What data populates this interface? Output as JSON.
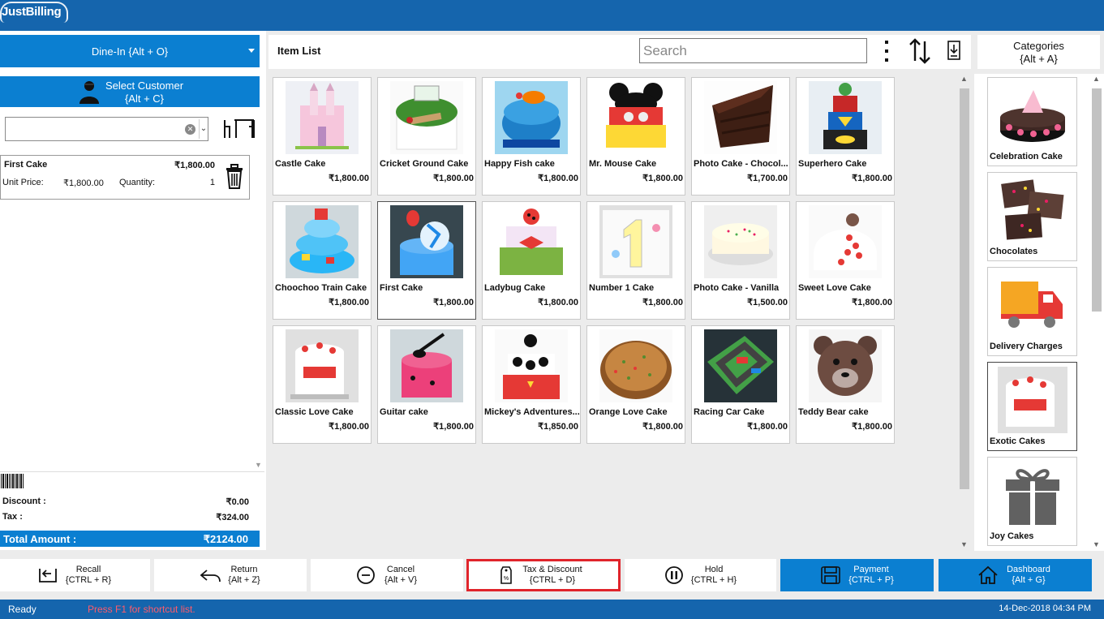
{
  "app": {
    "logo_text": "JustBilling"
  },
  "left": {
    "dine_in_label": "Dine-In {Alt + O}",
    "select_customer_line1": "Select Customer",
    "select_customer_line2": "{Alt + C}",
    "customer_input_value": "",
    "cart": [
      {
        "name": "First Cake",
        "amount": "₹1,800.00",
        "unit_price_label": "Unit Price:",
        "unit_price": "₹1,800.00",
        "quantity_label": "Quantity:",
        "quantity": "1"
      }
    ],
    "discount_label": "Discount :",
    "discount_value": "₹0.00",
    "tax_label": "Tax :",
    "tax_value": "₹324.00",
    "total_label": "Total Amount :",
    "total_value": "₹2124.00"
  },
  "item_list": {
    "title": "Item List",
    "search_placeholder": "Search",
    "items": [
      {
        "name": "Castle Cake",
        "price": "₹1,800.00"
      },
      {
        "name": "Cricket Ground Cake",
        "price": "₹1,800.00"
      },
      {
        "name": "Happy Fish cake",
        "price": "₹1,800.00"
      },
      {
        "name": "Mr. Mouse Cake",
        "price": "₹1,800.00"
      },
      {
        "name": "Photo Cake - Chocol...",
        "price": "₹1,700.00"
      },
      {
        "name": "Superhero Cake",
        "price": "₹1,800.00"
      },
      {
        "name": "Choochoo Train Cake",
        "price": "₹1,800.00"
      },
      {
        "name": "First Cake",
        "price": "₹1,800.00"
      },
      {
        "name": "Ladybug Cake",
        "price": "₹1,800.00"
      },
      {
        "name": "Number 1 Cake",
        "price": "₹1,800.00"
      },
      {
        "name": "Photo Cake - Vanilla",
        "price": "₹1,500.00"
      },
      {
        "name": "Sweet Love Cake",
        "price": "₹1,800.00"
      },
      {
        "name": "Classic Love Cake",
        "price": "₹1,800.00"
      },
      {
        "name": "Guitar cake",
        "price": "₹1,800.00"
      },
      {
        "name": "Mickey's Adventures...",
        "price": "₹1,850.00"
      },
      {
        "name": "Orange Love Cake",
        "price": "₹1,800.00"
      },
      {
        "name": "Racing Car Cake",
        "price": "₹1,800.00"
      },
      {
        "name": "Teddy Bear cake",
        "price": "₹1,800.00"
      }
    ]
  },
  "categories": {
    "title_line1": "Categories",
    "title_line2": "{Alt + A}",
    "items": [
      {
        "name": "Celebration Cake"
      },
      {
        "name": "Chocolates"
      },
      {
        "name": "Delivery Charges"
      },
      {
        "name": "Exotic Cakes"
      },
      {
        "name": "Joy Cakes"
      }
    ]
  },
  "actions": [
    {
      "line1": "Recall",
      "line2": "{CTRL + R}"
    },
    {
      "line1": "Return",
      "line2": "{Alt + Z}"
    },
    {
      "line1": "Cancel",
      "line2": "{Alt + V}"
    },
    {
      "line1": "Tax & Discount",
      "line2": "{CTRL + D}"
    },
    {
      "line1": "Hold",
      "line2": "{CTRL + H}"
    },
    {
      "line1": "Payment",
      "line2": "{CTRL + P}"
    },
    {
      "line1": "Dashboard",
      "line2": "{Alt + G}"
    }
  ],
  "status": {
    "ready": "Ready",
    "hint": "Press F1 for shortcut list.",
    "datetime": "14-Dec-2018 04:34 PM"
  },
  "colors": {
    "brand_blue": "#1565ad",
    "accent_blue": "#0b7fd1",
    "highlight_red": "#e0242b",
    "hint_red": "#ff5b6a"
  }
}
